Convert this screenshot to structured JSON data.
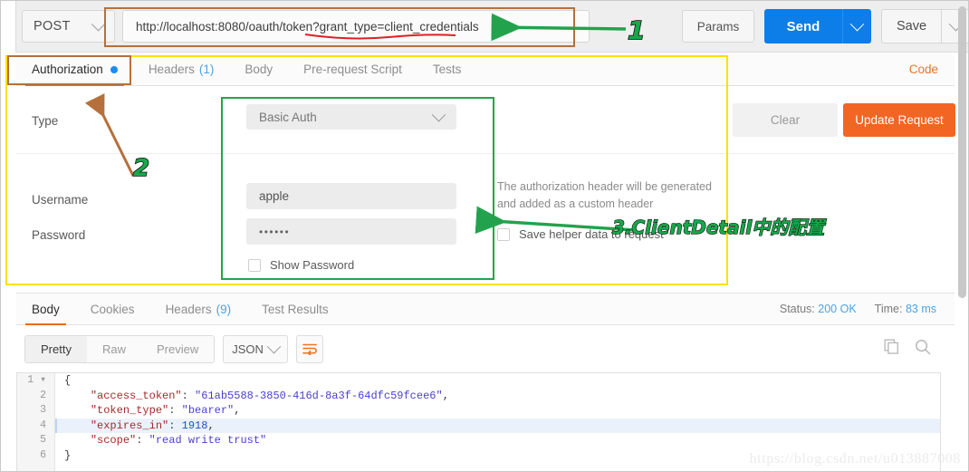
{
  "request_bar": {
    "method": "POST",
    "url": "http://localhost:8080/oauth/token?grant_type=client_credentials",
    "params_label": "Params",
    "send_label": "Send",
    "save_label": "Save"
  },
  "request_tabs": {
    "items": [
      {
        "label": "Authorization",
        "count": "",
        "active": true,
        "dot": true
      },
      {
        "label": "Headers",
        "count": "(1)",
        "active": false,
        "dot": false
      },
      {
        "label": "Body",
        "count": "",
        "active": false,
        "dot": false
      },
      {
        "label": "Pre-request Script",
        "count": "",
        "active": false,
        "dot": false
      },
      {
        "label": "Tests",
        "count": "",
        "active": false,
        "dot": false
      }
    ],
    "code_link": "Code"
  },
  "authorization": {
    "type_label": "Type",
    "type_value": "Basic Auth",
    "username_label": "Username",
    "username_value": "apple",
    "password_label": "Password",
    "password_value": "••••••",
    "show_password_label": "Show Password",
    "helper_text": "The authorization header will be generated and added as a custom header",
    "save_helper_label": "Save helper data to request",
    "clear_label": "Clear",
    "update_label": "Update Request"
  },
  "response_tabs": {
    "items": [
      {
        "label": "Body",
        "count": "",
        "active": true
      },
      {
        "label": "Cookies",
        "count": "",
        "active": false
      },
      {
        "label": "Headers",
        "count": "(9)",
        "active": false
      },
      {
        "label": "Test Results",
        "count": "",
        "active": false
      }
    ],
    "status_label": "Status:",
    "status_value": "200 OK",
    "time_label": "Time:",
    "time_value": "83 ms"
  },
  "body_toolbar": {
    "views": [
      {
        "label": "Pretty",
        "active": true
      },
      {
        "label": "Raw",
        "active": false
      },
      {
        "label": "Preview",
        "active": false
      }
    ],
    "format": "JSON",
    "wrap_icon": "word-wrap-icon",
    "copy_icon": "copy-icon",
    "search_icon": "search-icon"
  },
  "response_body": {
    "line_numbers": [
      "1",
      "2",
      "3",
      "4",
      "5",
      "6"
    ],
    "highlighted_line": 4,
    "lines": [
      {
        "indent": 0,
        "tokens": [
          {
            "t": "p",
            "v": "{"
          }
        ]
      },
      {
        "indent": 1,
        "tokens": [
          {
            "t": "k",
            "v": "\"access_token\""
          },
          {
            "t": "p",
            "v": ": "
          },
          {
            "t": "s",
            "v": "\"61ab5588-3850-416d-8a3f-64dfc59fcee6\""
          },
          {
            "t": "p",
            "v": ","
          }
        ]
      },
      {
        "indent": 1,
        "tokens": [
          {
            "t": "k",
            "v": "\"token_type\""
          },
          {
            "t": "p",
            "v": ": "
          },
          {
            "t": "s",
            "v": "\"bearer\""
          },
          {
            "t": "p",
            "v": ","
          }
        ]
      },
      {
        "indent": 1,
        "tokens": [
          {
            "t": "k",
            "v": "\"expires_in\""
          },
          {
            "t": "p",
            "v": ": "
          },
          {
            "t": "n",
            "v": "1918"
          },
          {
            "t": "p",
            "v": ","
          }
        ]
      },
      {
        "indent": 1,
        "tokens": [
          {
            "t": "k",
            "v": "\"scope\""
          },
          {
            "t": "p",
            "v": ": "
          },
          {
            "t": "s",
            "v": "\"read write trust\""
          }
        ]
      },
      {
        "indent": 0,
        "tokens": [
          {
            "t": "p",
            "v": "}"
          }
        ]
      }
    ]
  },
  "annotations": {
    "marker_1": "1",
    "marker_2": "2",
    "marker_3": "3.ClientDetail中的配置",
    "colors": {
      "brown_box": "#b5703c",
      "yellow_box": "#ffe000",
      "green_box": "#1fa74a",
      "green_arrow": "#23a css",
      "red_underline": "#e02020",
      "marker_text": "#17a84a"
    }
  },
  "watermark": "https://blog.csdn.net/u013887008"
}
